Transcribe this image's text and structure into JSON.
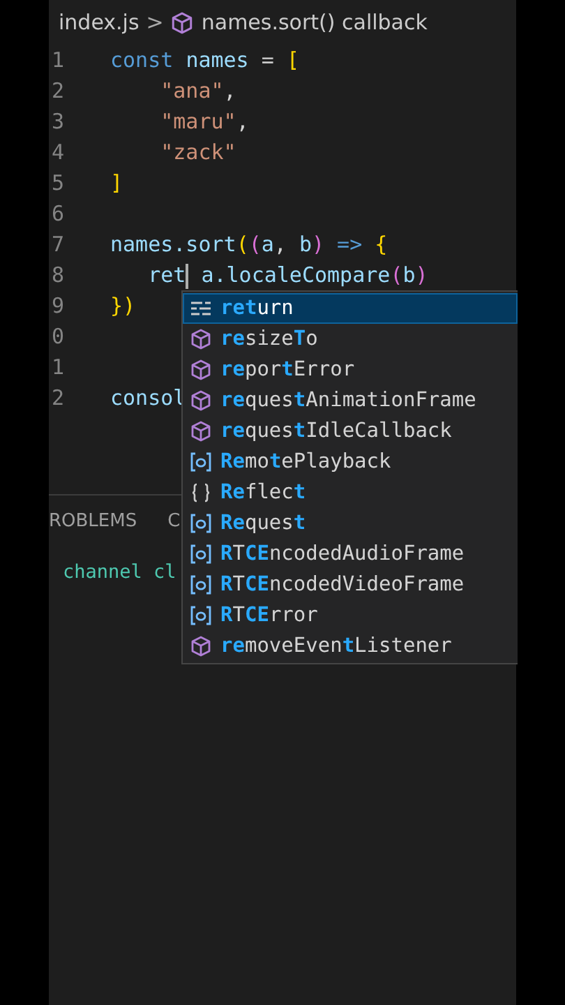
{
  "breadcrumb": {
    "file": "index.js",
    "separator": ">",
    "symbol": "names.sort() callback"
  },
  "lines": [
    {
      "number": "1",
      "tokens": [
        {
          "text": "const ",
          "kind": "keyword"
        },
        {
          "text": "names",
          "kind": "variable"
        },
        {
          "text": " = ",
          "kind": "punct"
        },
        {
          "text": "[",
          "kind": "bracket"
        }
      ]
    },
    {
      "number": "2",
      "tokens": [
        {
          "text": "    \"ana\"",
          "kind": "string"
        },
        {
          "text": ",",
          "kind": "punct"
        }
      ]
    },
    {
      "number": "3",
      "tokens": [
        {
          "text": "    \"maru\"",
          "kind": "string"
        },
        {
          "text": ",",
          "kind": "punct"
        }
      ]
    },
    {
      "number": "4",
      "tokens": [
        {
          "text": "    \"zack\"",
          "kind": "string"
        }
      ]
    },
    {
      "number": "5",
      "tokens": [
        {
          "text": "]",
          "kind": "bracket"
        }
      ]
    },
    {
      "number": "6"
    },
    {
      "number": "7",
      "tokens": [
        {
          "text": "names",
          "kind": "variable"
        },
        {
          "text": ".sort",
          "kind": "variable"
        },
        {
          "text": "(",
          "kind": "bracket"
        },
        {
          "text": "(",
          "kind": "bracket2"
        },
        {
          "text": "a",
          "kind": "variable"
        },
        {
          "text": ", ",
          "kind": "punct"
        },
        {
          "text": "b",
          "kind": "variable"
        },
        {
          "text": ")",
          "kind": "bracket2"
        },
        {
          "text": " => ",
          "kind": "keyword"
        },
        {
          "text": "{",
          "kind": "bracket"
        }
      ]
    },
    {
      "number": "8",
      "tokens": [
        {
          "text": "   ret",
          "kind": "variable",
          "caret": true
        },
        {
          "text": " a.localeCompare",
          "kind": "variable"
        },
        {
          "text": "(",
          "kind": "bracket2"
        },
        {
          "text": "b",
          "kind": "variable"
        },
        {
          "text": ")",
          "kind": "bracket2"
        }
      ]
    },
    {
      "number": "9",
      "tokens": [
        {
          "text": "}",
          "kind": "bracket"
        },
        {
          "text": ")",
          "kind": "bracket"
        }
      ]
    },
    {
      "number": "0"
    },
    {
      "number": "1"
    },
    {
      "number": "2",
      "tokens": [
        {
          "text": "consol",
          "kind": "variable"
        }
      ]
    }
  ],
  "suggestions": [
    {
      "kind": "keyword",
      "selected": true,
      "segments": [
        {
          "text": "ret",
          "match": true
        },
        {
          "text": "urn",
          "match": false
        }
      ]
    },
    {
      "kind": "method",
      "selected": false,
      "segments": [
        {
          "text": "re",
          "match": true
        },
        {
          "text": "size",
          "match": false
        },
        {
          "text": "T",
          "match": true
        },
        {
          "text": "o",
          "match": false
        }
      ]
    },
    {
      "kind": "method",
      "selected": false,
      "segments": [
        {
          "text": "re",
          "match": true
        },
        {
          "text": "por",
          "match": false
        },
        {
          "text": "t",
          "match": true
        },
        {
          "text": "Error",
          "match": false
        }
      ]
    },
    {
      "kind": "method",
      "selected": false,
      "segments": [
        {
          "text": "re",
          "match": true
        },
        {
          "text": "ques",
          "match": false
        },
        {
          "text": "t",
          "match": true
        },
        {
          "text": "AnimationFrame",
          "match": false
        }
      ]
    },
    {
      "kind": "method",
      "selected": false,
      "segments": [
        {
          "text": "re",
          "match": true
        },
        {
          "text": "ques",
          "match": false
        },
        {
          "text": "t",
          "match": true
        },
        {
          "text": "IdleCallback",
          "match": false
        }
      ]
    },
    {
      "kind": "variable",
      "selected": false,
      "segments": [
        {
          "text": "Re",
          "match": true
        },
        {
          "text": "mo",
          "match": false
        },
        {
          "text": "t",
          "match": true
        },
        {
          "text": "ePlayback",
          "match": false
        }
      ]
    },
    {
      "kind": "module",
      "selected": false,
      "segments": [
        {
          "text": "Re",
          "match": true
        },
        {
          "text": "flec",
          "match": false
        },
        {
          "text": "t",
          "match": true
        }
      ]
    },
    {
      "kind": "variable",
      "selected": false,
      "segments": [
        {
          "text": "Re",
          "match": true
        },
        {
          "text": "ques",
          "match": false
        },
        {
          "text": "t",
          "match": true
        }
      ]
    },
    {
      "kind": "variable",
      "selected": false,
      "segments": [
        {
          "text": "R",
          "match": true
        },
        {
          "text": "T",
          "match": false
        },
        {
          "text": "CE",
          "match": true
        },
        {
          "text": "ncodedAudioFrame",
          "match": false
        }
      ]
    },
    {
      "kind": "variable",
      "selected": false,
      "segments": [
        {
          "text": "R",
          "match": true
        },
        {
          "text": "T",
          "match": false
        },
        {
          "text": "CE",
          "match": true
        },
        {
          "text": "ncodedVideoFrame",
          "match": false
        }
      ]
    },
    {
      "kind": "variable",
      "selected": false,
      "segments": [
        {
          "text": "R",
          "match": true
        },
        {
          "text": "T",
          "match": false
        },
        {
          "text": "CE",
          "match": true
        },
        {
          "text": "rror",
          "match": false
        }
      ]
    },
    {
      "kind": "method",
      "selected": false,
      "segments": [
        {
          "text": "re",
          "match": true
        },
        {
          "text": "moveEven",
          "match": false
        },
        {
          "text": "t",
          "match": true
        },
        {
          "text": "Listener",
          "match": false
        }
      ]
    }
  ],
  "panel": {
    "tabs": [
      {
        "label": "ROBLEMS"
      },
      {
        "label": "C"
      }
    ],
    "output": "channel cl"
  }
}
